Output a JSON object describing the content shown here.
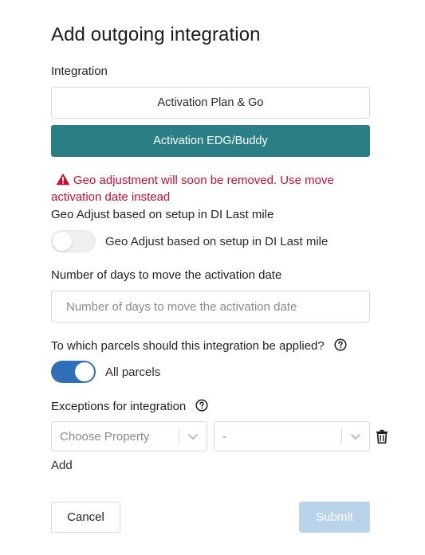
{
  "dialog": {
    "title": "Add outgoing integration"
  },
  "integration": {
    "label": "Integration",
    "options": [
      {
        "label": "Activation Plan & Go",
        "selected": false
      },
      {
        "label": "Activation EDG/Buddy",
        "selected": true
      }
    ]
  },
  "warning": {
    "text": "Geo adjustment will soon be removed. Use move activation date instead",
    "icon": "warning-triangle-icon",
    "color": "#c8102e"
  },
  "geo_adjust": {
    "label": "Geo Adjust based on setup in DI Last mile",
    "toggle_label": "Geo Adjust based on setup in DI Last mile",
    "enabled": false
  },
  "days": {
    "label": "Number of days to move the activation date",
    "placeholder": "Number of days to move the activation date",
    "value": ""
  },
  "parcels": {
    "label": "To which parcels should this integration be applied?",
    "toggle_label": "All parcels",
    "enabled": true
  },
  "exceptions": {
    "label": "Exceptions for integration",
    "property_placeholder": "Choose Property",
    "value_placeholder": "-",
    "add_label": "Add"
  },
  "footer": {
    "cancel_label": "Cancel",
    "submit_label": "Submit",
    "submit_disabled": true
  },
  "colors": {
    "accent": "#2a7f87",
    "toggle_on": "#2f6fb8",
    "submit_disabled": "#b9d4ea"
  }
}
